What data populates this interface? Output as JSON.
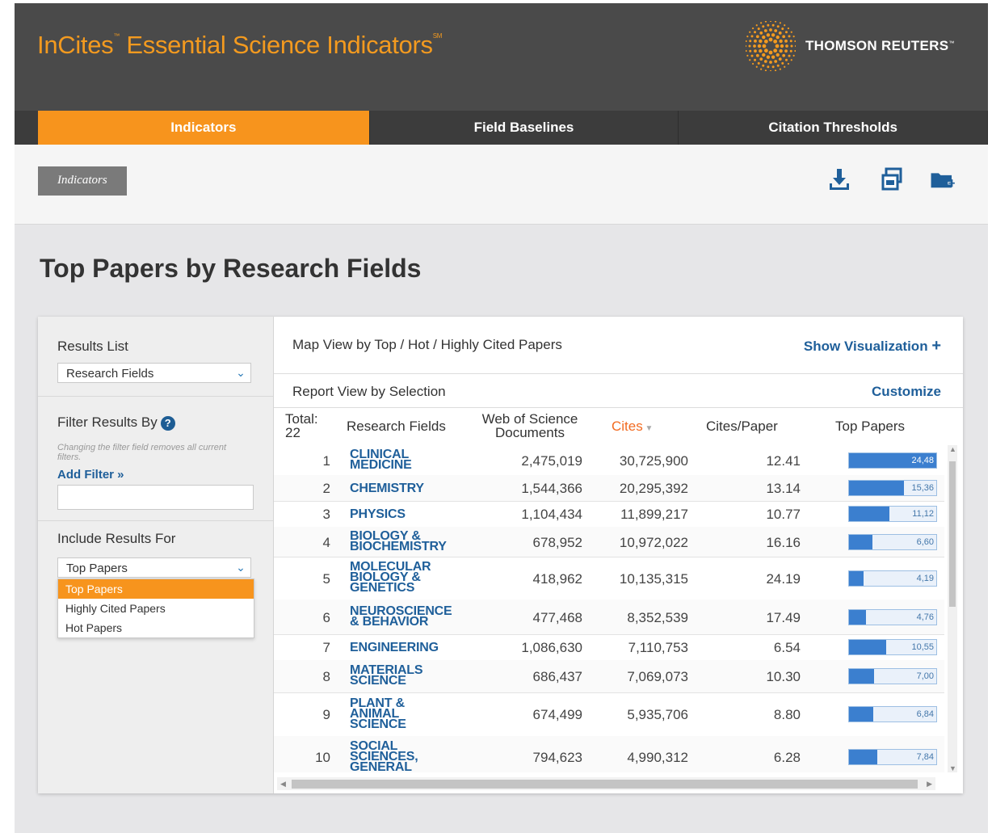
{
  "header": {
    "app_title": "InCites",
    "tm1": "™",
    "app_title_rest": " Essential Science Indicators",
    "tm2": "SM",
    "brand": "THOMSON REUTERS",
    "brand_tm": "™"
  },
  "nav": {
    "tabs": [
      {
        "label": "Indicators",
        "active": true
      },
      {
        "label": "Field Baselines",
        "active": false
      },
      {
        "label": "Citation Thresholds",
        "active": false
      }
    ]
  },
  "subbar": {
    "breadcrumb": "Indicators",
    "tools": [
      "download-icon",
      "print-icon",
      "add-folder-icon"
    ]
  },
  "page": {
    "title": "Top Papers by Research Fields"
  },
  "sidebar": {
    "results_list_title": "Results List",
    "results_list_value": "Research Fields",
    "filter_title": "Filter Results By",
    "filter_note": "Changing the filter field removes all current filters.",
    "add_filter": "Add Filter »",
    "include_title": "Include Results For",
    "include_value": "Top Papers",
    "include_options": [
      "Top Papers",
      "Highly Cited Papers",
      "Hot Papers"
    ]
  },
  "main": {
    "map_label": "Map View by Top / Hot / Highly Cited Papers",
    "show_visualization": "Show Visualization",
    "report_label": "Report View by Selection",
    "customize": "Customize",
    "total_label": "Total:",
    "total_value": "22",
    "columns": [
      "Research Fields",
      "Web of Science Documents",
      "Cites",
      "Cites/Paper",
      "Top Papers"
    ],
    "accent": "#f7941d",
    "link_color": "#1f5f9a"
  },
  "rows": [
    {
      "rank": "1",
      "field": [
        "CLINICAL",
        "MEDICINE"
      ],
      "docs": "2,475,019",
      "cites": "30,725,900",
      "cpp": "12.41",
      "top": "24,48",
      "frac": 1.0
    },
    {
      "rank": "2",
      "field": [
        "CHEMISTRY"
      ],
      "docs": "1,544,366",
      "cites": "20,295,392",
      "cpp": "13.14",
      "top": "15,36",
      "frac": 0.63
    },
    {
      "rank": "3",
      "field": [
        "PHYSICS"
      ],
      "docs": "1,104,434",
      "cites": "11,899,217",
      "cpp": "10.77",
      "top": "11,12",
      "frac": 0.46
    },
    {
      "rank": "4",
      "field": [
        "BIOLOGY &",
        "BIOCHEMISTRY"
      ],
      "docs": "678,952",
      "cites": "10,972,022",
      "cpp": "16.16",
      "top": "6,60",
      "frac": 0.27
    },
    {
      "rank": "5",
      "field": [
        "MOLECULAR",
        "BIOLOGY &",
        "GENETICS"
      ],
      "docs": "418,962",
      "cites": "10,135,315",
      "cpp": "24.19",
      "top": "4,19",
      "frac": 0.17
    },
    {
      "rank": "6",
      "field": [
        "NEUROSCIENCE",
        "& BEHAVIOR"
      ],
      "docs": "477,468",
      "cites": "8,352,539",
      "cpp": "17.49",
      "top": "4,76",
      "frac": 0.19
    },
    {
      "rank": "7",
      "field": [
        "ENGINEERING"
      ],
      "docs": "1,086,630",
      "cites": "7,110,753",
      "cpp": "6.54",
      "top": "10,55",
      "frac": 0.43
    },
    {
      "rank": "8",
      "field": [
        "MATERIALS",
        "SCIENCE"
      ],
      "docs": "686,437",
      "cites": "7,069,073",
      "cpp": "10.30",
      "top": "7,00",
      "frac": 0.29
    },
    {
      "rank": "9",
      "field": [
        "PLANT &",
        "ANIMAL",
        "SCIENCE"
      ],
      "docs": "674,499",
      "cites": "5,935,706",
      "cpp": "8.80",
      "top": "6,84",
      "frac": 0.28
    },
    {
      "rank": "10",
      "field": [
        "SOCIAL",
        "SCIENCES,",
        "GENERAL"
      ],
      "docs": "794,623",
      "cites": "4,990,312",
      "cpp": "6.28",
      "top": "7,84",
      "frac": 0.32
    }
  ]
}
